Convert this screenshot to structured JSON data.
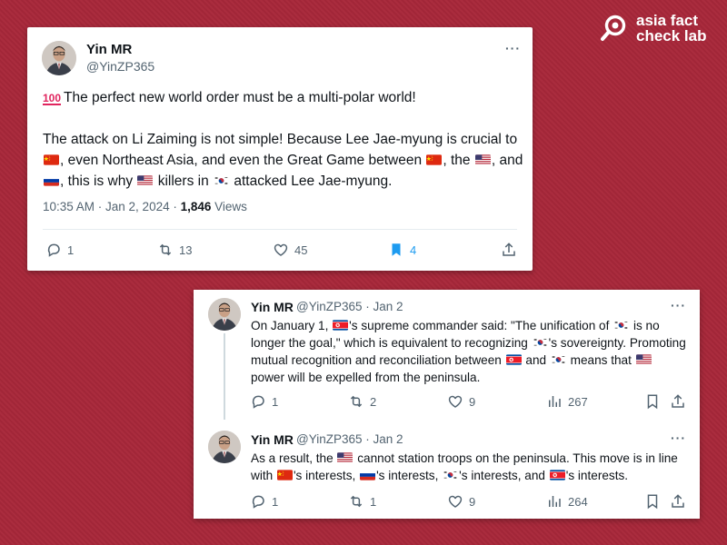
{
  "brand": {
    "line1": "asia fact",
    "line2": "check lab"
  },
  "tweet1": {
    "author": "Yin MR",
    "handle": "@YinZP365",
    "more": "···",
    "line1": "The perfect new world order must be a multi-polar world!",
    "p2a": "The attack on Li Zaiming is not simple!  Because Lee Jae-myung is crucial to ",
    "p2b": ", even Northeast Asia, and even the Great Game between ",
    "p2c": ", the ",
    "p2d": ", and ",
    "p2e": ", this is why ",
    "p2f": " killers in ",
    "p2g": " attacked Lee Jae-myung.",
    "time": "10:35 AM · Jan 2, 2024 · ",
    "views_count": "1,846",
    "views_label": " Views",
    "replies": "1",
    "retweets": "13",
    "likes": "45",
    "bookmarks": "4"
  },
  "tweet2": {
    "author": "Yin MR",
    "handle": "@YinZP365 · Jan 2",
    "more": "···",
    "a": "On January 1, ",
    "b": "'s supreme commander said: \"The unification of ",
    "c": " is no longer the goal,\" which is equivalent to recognizing ",
    "d": "'s sovereignty. Promoting mutual recognition and reconciliation between ",
    "e": " and ",
    "f": " means that ",
    "g": " power will be expelled from the peninsula.",
    "replies": "1",
    "retweets": "2",
    "likes": "9",
    "views": "267"
  },
  "tweet3": {
    "author": "Yin MR",
    "handle": "@YinZP365 · Jan 2",
    "more": "···",
    "a": "As a result, the ",
    "b": " cannot station troops on the peninsula. This move is in line with ",
    "c": "'s interests, ",
    "d": "'s interests, ",
    "e": "'s interests, and ",
    "f": "'s interests.",
    "replies": "1",
    "retweets": "1",
    "likes": "9",
    "views": "264"
  },
  "icons": [
    "hundred-points-icon",
    "china-flag-icon",
    "usa-flag-icon",
    "russia-flag-icon",
    "south-korea-flag-icon",
    "north-korea-flag-icon",
    "reply-icon",
    "retweet-icon",
    "like-icon",
    "bookmark-icon",
    "share-icon",
    "views-icon"
  ],
  "colors": {
    "background": "#a8283a",
    "bookmark_active": "#1d9bf0",
    "muted": "#536471"
  }
}
